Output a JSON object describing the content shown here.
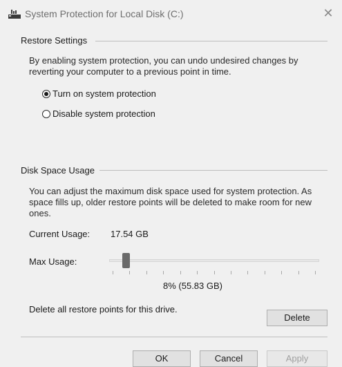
{
  "window": {
    "title": "System Protection for Local Disk (C:)",
    "close_glyph": "✕",
    "icon": "drive-icon"
  },
  "restore": {
    "group_title": "Restore Settings",
    "description_line1": "By enabling system protection, you can undo undesired changes by",
    "description_line2": "reverting your computer to a previous point in time.",
    "options": [
      {
        "label": "Turn on system protection",
        "selected": true
      },
      {
        "label": "Disable system protection",
        "selected": false
      }
    ]
  },
  "disk": {
    "group_title": "Disk Space Usage",
    "description_line1": "You can adjust the maximum disk space used for system protection. As",
    "description_line2": "space fills up, older restore points will be deleted to make room for new",
    "description_line3": "ones.",
    "current_usage_label": "Current Usage:",
    "current_usage_value": "17.54 GB",
    "max_usage_label": "Max Usage:",
    "max_usage_value": "8% (55.83 GB)",
    "max_usage_fraction": 0.08,
    "delete_text": "Delete all restore points for this drive.",
    "delete_button": "Delete"
  },
  "footer": {
    "ok": "OK",
    "cancel": "Cancel",
    "apply": "Apply"
  },
  "colors": {
    "background": "#f0f0f0",
    "button": "#e1e1e1",
    "separator": "#bdbdbd"
  }
}
